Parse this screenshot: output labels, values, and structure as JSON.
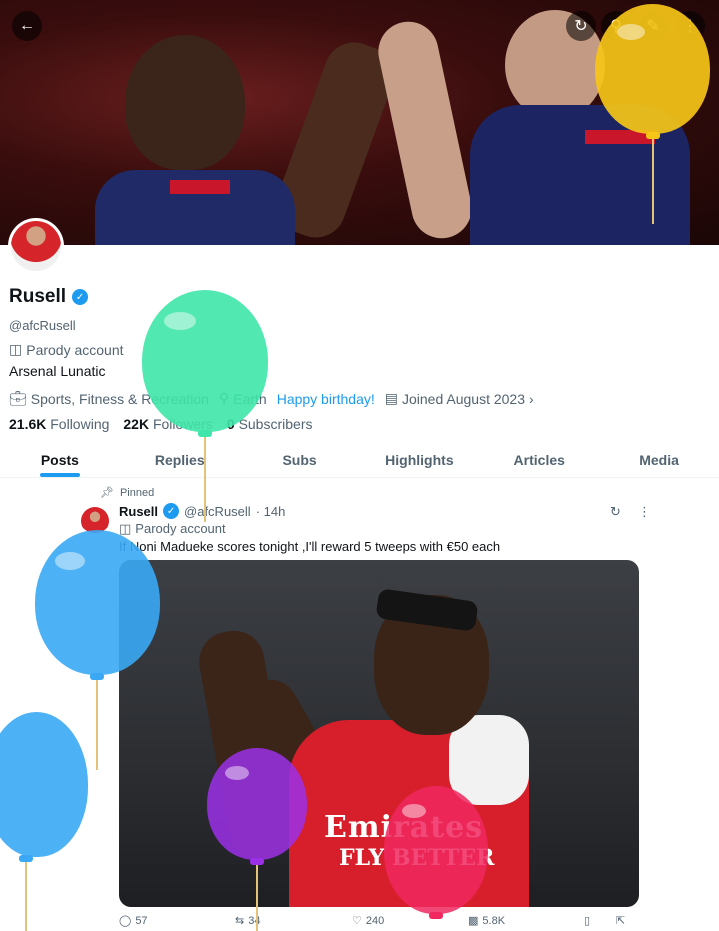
{
  "header": {
    "back_icon": "arrow-left-icon",
    "action_icons": [
      "refresh-icon",
      "search-icon",
      "edit-icon",
      "more-vertical-icon"
    ]
  },
  "profile": {
    "name": "Rusell",
    "handle": "@afcRusell",
    "parody_label": "Parody account",
    "bio": "Arsenal Lunatic",
    "category": "Sports, Fitness & Recreation",
    "location": "Earth",
    "birthday": "Happy birthday!",
    "joined": "Joined August 2023",
    "following_count": "21.6K",
    "following_label": "Following",
    "followers_count": "22K",
    "followers_label": "Followers",
    "subscribers_count": "0",
    "subscribers_label": "Subscribers",
    "accent_color": "#1d9bf0"
  },
  "tabs": [
    {
      "label": "Posts",
      "active": true
    },
    {
      "label": "Replies"
    },
    {
      "label": "Subs"
    },
    {
      "label": "Highlights"
    },
    {
      "label": "Articles"
    },
    {
      "label": "Media"
    }
  ],
  "post": {
    "pinned_label": "Pinned",
    "author": "Rusell",
    "handle": "@afcRusell",
    "time": "· 14h",
    "parody_label": "Parody account",
    "text": "If Noni Madueke scores tonight ,I'll reward 5 tweeps with €50 each",
    "image_text_1": "Emirates",
    "image_text_2": "FLY BETTER",
    "replies": "57",
    "reposts": "34",
    "likes": "240",
    "views": "5.8K"
  },
  "balloons": [
    {
      "color": "#f5c518"
    },
    {
      "color": "#3ee6a9"
    },
    {
      "color": "#3aa8f5"
    },
    {
      "color": "#3aa8f5"
    },
    {
      "color": "#9b30e8"
    },
    {
      "color": "#f0285f"
    }
  ]
}
